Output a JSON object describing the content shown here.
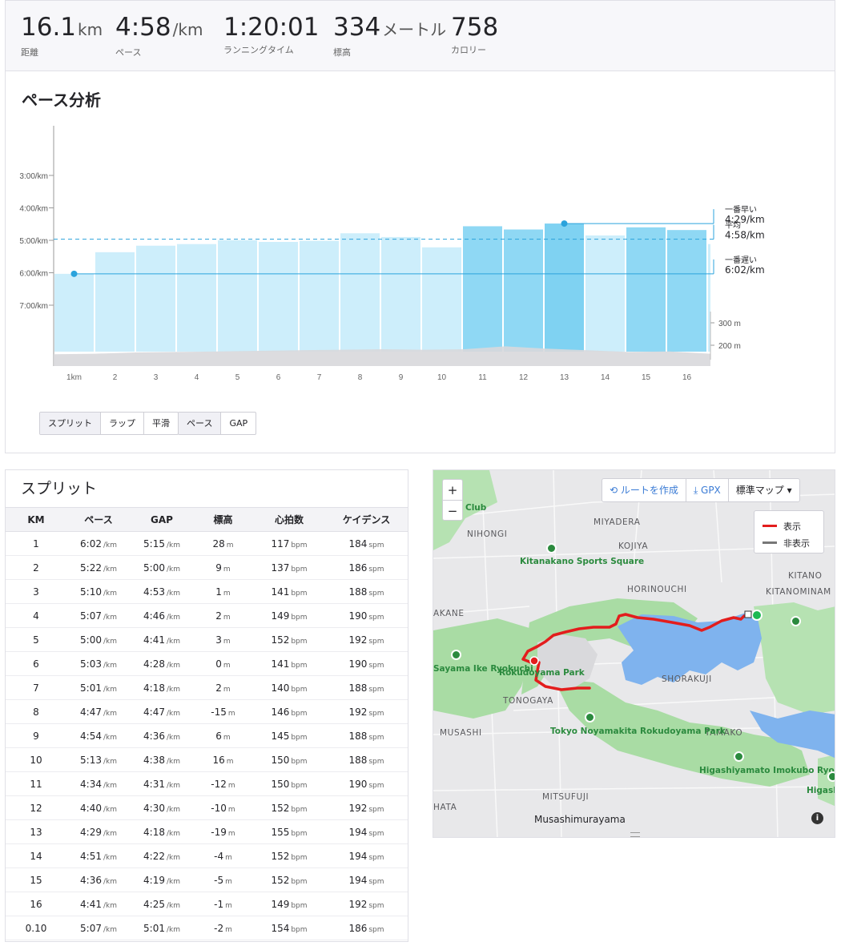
{
  "stats": [
    {
      "value": "16.1",
      "unit": "km",
      "label": "距離"
    },
    {
      "value": "4:58",
      "unit": "/km",
      "label": "ペース"
    },
    {
      "value": "1:20:01",
      "unit": "",
      "label": "ランニングタイム"
    },
    {
      "value": "334",
      "unit": "メートル",
      "label": "標高"
    },
    {
      "value": "758",
      "unit": "",
      "label": "カロリー"
    }
  ],
  "pace_analysis": {
    "title": "ペース分析",
    "buttons_mode": [
      {
        "label": "スプリット",
        "active": true
      },
      {
        "label": "ラップ",
        "active": false
      },
      {
        "label": "平滑",
        "active": false
      }
    ],
    "buttons_metric": [
      {
        "label": "ペース",
        "active": true
      },
      {
        "label": "GAP",
        "active": false
      }
    ]
  },
  "chart_data": {
    "type": "bar",
    "categories": [
      "1km",
      "2",
      "3",
      "4",
      "5",
      "6",
      "7",
      "8",
      "9",
      "10",
      "11",
      "12",
      "13",
      "14",
      "15",
      "16"
    ],
    "values_sec_per_km": [
      362,
      322,
      310,
      307,
      300,
      303,
      301,
      287,
      294,
      313,
      274,
      280,
      269,
      291,
      276,
      281
    ],
    "partial_last_sec_per_km": 307,
    "y_ticks": [
      "3:00/km",
      "4:00/km",
      "5:00/km",
      "6:00/km",
      "7:00/km"
    ],
    "y_tick_seconds": [
      180,
      240,
      300,
      360,
      420
    ],
    "elevation_ticks": [
      "300 m",
      "200 m"
    ],
    "elevation_tick_values": [
      300,
      200
    ],
    "elevation_profile_m": [
      160,
      162,
      168,
      170,
      172,
      175,
      178,
      180,
      182,
      180,
      182,
      195,
      185,
      178,
      170,
      172,
      162
    ],
    "reference_lines": [
      {
        "caption": "一番早い",
        "value": "4:29/km",
        "seconds": 269,
        "style": "marker"
      },
      {
        "caption": "平均",
        "value": "4:58/km",
        "seconds": 298,
        "style": "dashed"
      },
      {
        "caption": "一番遅い",
        "value": "6:02/km",
        "seconds": 362,
        "style": "marker"
      }
    ],
    "highlight_colors": {
      "light": "#cdeefb",
      "mid": "#a9e2f6",
      "strong": "#7fd2f2",
      "line": "#2ba3dc",
      "elevation": "#d8d8dc"
    }
  },
  "splits": {
    "title": "スプリット",
    "columns": [
      "KM",
      "ペース",
      "GAP",
      "標高",
      "心拍数",
      "ケイデンス"
    ],
    "rows": [
      [
        "1",
        "6:02",
        "5:15",
        "28",
        "117",
        "184"
      ],
      [
        "2",
        "5:22",
        "5:00",
        "9",
        "137",
        "186"
      ],
      [
        "3",
        "5:10",
        "4:53",
        "1",
        "141",
        "188"
      ],
      [
        "4",
        "5:07",
        "4:46",
        "2",
        "149",
        "190"
      ],
      [
        "5",
        "5:00",
        "4:41",
        "3",
        "152",
        "192"
      ],
      [
        "6",
        "5:03",
        "4:28",
        "0",
        "141",
        "190"
      ],
      [
        "7",
        "5:01",
        "4:18",
        "2",
        "140",
        "188"
      ],
      [
        "8",
        "4:47",
        "4:47",
        "-15",
        "146",
        "192"
      ],
      [
        "9",
        "4:54",
        "4:36",
        "6",
        "145",
        "188"
      ],
      [
        "10",
        "5:13",
        "4:38",
        "16",
        "150",
        "188"
      ],
      [
        "11",
        "4:34",
        "4:31",
        "-12",
        "150",
        "190"
      ],
      [
        "12",
        "4:40",
        "4:30",
        "-10",
        "152",
        "192"
      ],
      [
        "13",
        "4:29",
        "4:18",
        "-19",
        "155",
        "194"
      ],
      [
        "14",
        "4:51",
        "4:22",
        "-4",
        "152",
        "194"
      ],
      [
        "15",
        "4:36",
        "4:19",
        "-5",
        "152",
        "194"
      ],
      [
        "16",
        "4:41",
        "4:25",
        "-1",
        "149",
        "192"
      ],
      [
        "0.10",
        "5:07",
        "5:01",
        "-2",
        "154",
        "186"
      ]
    ],
    "units": {
      "pace": "/km",
      "elev": "m",
      "hr": "bpm",
      "cad": "spm"
    }
  },
  "map": {
    "toolbar": [
      "ルートを作成",
      "GPX",
      "標準マップ"
    ],
    "legend": [
      {
        "label": "表示",
        "color": "#e31d1d"
      },
      {
        "label": "非表示",
        "color": "#777777"
      }
    ],
    "area_labels": [
      "NIHONGI",
      "MIYADERA",
      "KOJIYA",
      "HORINOUCHI",
      "KITANO",
      "KITANOMINAM",
      "AKANE",
      "SHORAKUJI",
      "TONOGAYA",
      "MUSASHI",
      "TAMAKO",
      "MITSUFUJI",
      "HATA"
    ],
    "pois": [
      "Kitanakano Sports Square",
      "Sayama Ike Ryokuchi",
      "Rokudoyama Park",
      "Tokyo Noyamakita Rokudoyama Park",
      "Higashiyamato Imokubo Ryokuchi",
      "Club",
      "Higash Ryoku"
    ],
    "city": "Musashimurayama",
    "zoom_in": "+",
    "zoom_out": "−"
  }
}
